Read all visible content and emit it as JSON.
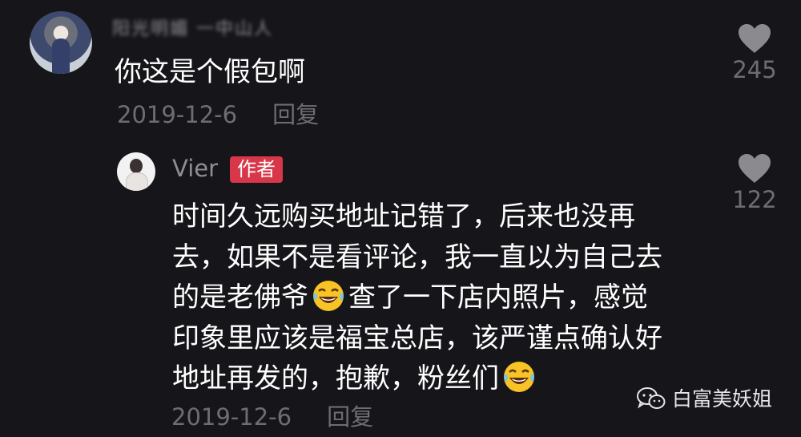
{
  "comment": {
    "username": "阳光明媚 一中山人",
    "text": "你这是个假包啊",
    "date": "2019-12-6",
    "reply_label": "回复",
    "likes": "245"
  },
  "reply": {
    "username": "Vier",
    "badge": "作者",
    "lines": {
      "l1": "时间久远购买地址记错了，后来也没再",
      "l2": "去，如果不是看评论，我一直以为自己去",
      "l3a": "的是老佛爷",
      "l3b": "查了一下店内照片，感觉",
      "l4": "印象里应该是福宝总店，该严谨点确认好",
      "l5": "地址再发的，抱歉，粉丝们"
    },
    "date": "2019-12-6",
    "reply_label": "回复",
    "likes": "122"
  },
  "watermark": {
    "text": "白富美妖姐"
  },
  "icons": {
    "heart": "heart-icon",
    "emoji": "laughing-crying-emoji-icon",
    "wechat": "wechat-icon"
  },
  "colors": {
    "background": "#15151a",
    "muted": "#6d6d73",
    "badge": "#d8374a",
    "heart": "#8a8a8f"
  }
}
